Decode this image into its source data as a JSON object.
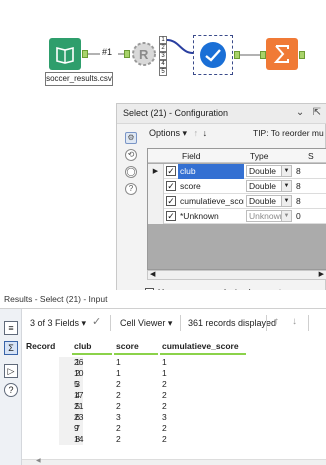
{
  "canvas": {
    "file_label": "soccer_results.csv",
    "connection_label": "#1",
    "r_anchor_labels": [
      "1",
      "2",
      "3",
      "4",
      "5"
    ]
  },
  "config": {
    "title": "Select (21) - Configuration",
    "options_label": "Options",
    "tip": "TIP: To reorder mu",
    "columns": {
      "field": "Field",
      "type": "Type",
      "size": "S"
    },
    "rows": [
      {
        "checked": true,
        "field": "club",
        "type": "Double",
        "size": "8",
        "active": true
      },
      {
        "checked": true,
        "field": "score",
        "type": "Double",
        "size": "8",
        "active": false
      },
      {
        "checked": true,
        "field": "cumulatieve_score",
        "type": "Double",
        "size": "8",
        "active": false
      },
      {
        "checked": true,
        "field": "*Unknown",
        "type": "Unknown",
        "size": "0",
        "active": false
      }
    ],
    "commas_label": "Use commas as decimal separators"
  },
  "results": {
    "title": "Results - Select (21) - Input",
    "fields_label": "3 of 3 Fields",
    "viewer_label": "Cell Viewer",
    "records_label": "361 records displayed",
    "columns": [
      "Record",
      "club",
      "score",
      "cumulatieve_score"
    ],
    "rows": [
      [
        "1",
        "26",
        "1",
        "1"
      ],
      [
        "2",
        "10",
        "1",
        "1"
      ],
      [
        "3",
        "5",
        "2",
        "2"
      ],
      [
        "4",
        "17",
        "2",
        "2"
      ],
      [
        "5",
        "21",
        "2",
        "2"
      ],
      [
        "6",
        "23",
        "3",
        "3"
      ],
      [
        "7",
        "9",
        "2",
        "2"
      ],
      [
        "8",
        "14",
        "2",
        "2"
      ]
    ]
  },
  "colors": {
    "input_tool": "#2e9e6c",
    "select_tool": "#1a6fd6",
    "summarize_tool": "#f07a36",
    "selection": "#3470d2",
    "header_underline": "#8bd24a"
  }
}
